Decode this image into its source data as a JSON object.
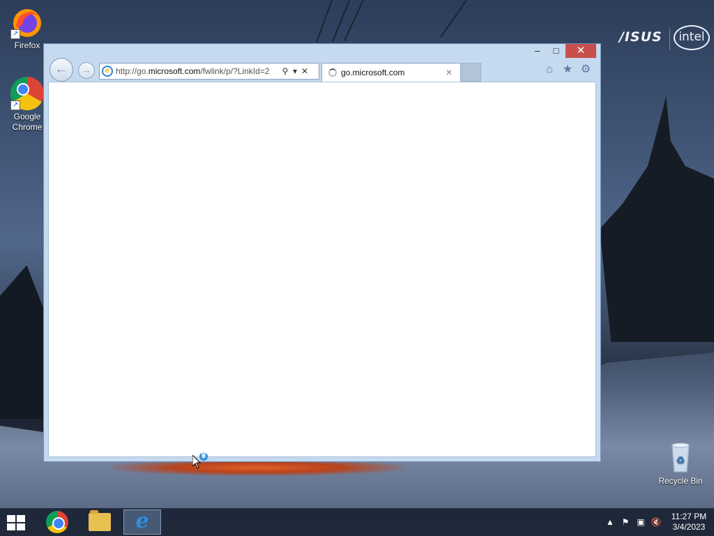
{
  "desktop": {
    "icons": [
      {
        "label": "Firefox"
      },
      {
        "label": "Google Chrome"
      },
      {
        "label": "Recycle Bin"
      }
    ],
    "brands": {
      "asus": "/ISUS",
      "intel": "intel"
    }
  },
  "browser": {
    "address": {
      "prefix": "http://go.",
      "domain": "microsoft.com",
      "suffix": "/fwlink/p/?LinkId=2"
    },
    "tab": {
      "title": "go.microsoft.com"
    },
    "controls": {
      "minimize": "–",
      "maximize": "□",
      "close": "✕"
    }
  },
  "taskbar": {
    "apps": [
      "start",
      "chrome",
      "file-explorer",
      "internet-explorer"
    ],
    "active_app": "internet-explorer",
    "clock": {
      "time": "11:27 PM",
      "date": "3/4/2023"
    }
  }
}
